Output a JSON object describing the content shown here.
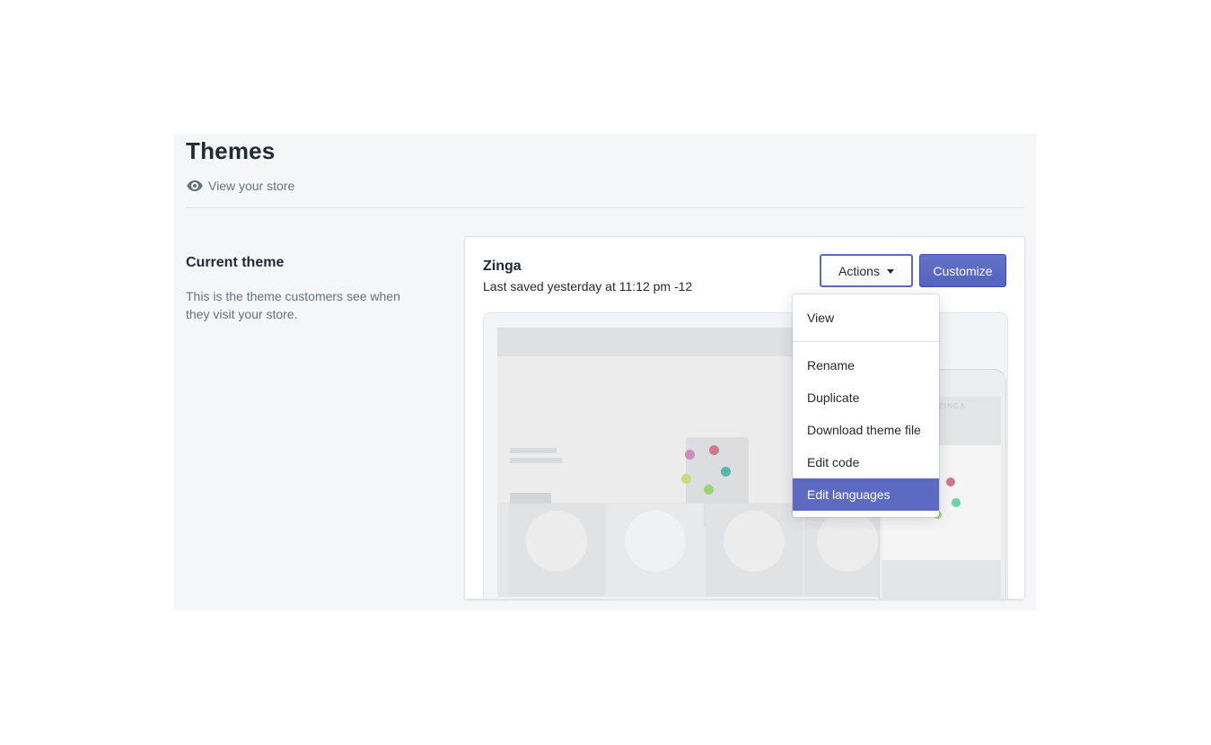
{
  "page": {
    "title": "Themes",
    "view_store_label": "View your store"
  },
  "section": {
    "title": "Current theme",
    "description": "This is the theme customers see when they visit your store."
  },
  "theme": {
    "name": "Zinga",
    "last_saved": "Last saved yesterday at 11:12 pm -12",
    "preview_phone_title": "ZINGA"
  },
  "buttons": {
    "actions_label": "Actions",
    "customize_label": "Customize"
  },
  "actions_menu": {
    "items": [
      {
        "label": "View"
      },
      {
        "label": "Rename"
      },
      {
        "label": "Duplicate"
      },
      {
        "label": "Download theme file"
      },
      {
        "label": "Edit code"
      },
      {
        "label": "Edit languages",
        "highlighted": true
      }
    ]
  },
  "colors": {
    "accent": "#5c6ac4",
    "panel_bg": "#f4f6f8",
    "text": "#212b36",
    "subdued_text": "#637381"
  },
  "icons": {
    "view_store": "eye-icon",
    "actions_caret": "caret-down-icon"
  }
}
